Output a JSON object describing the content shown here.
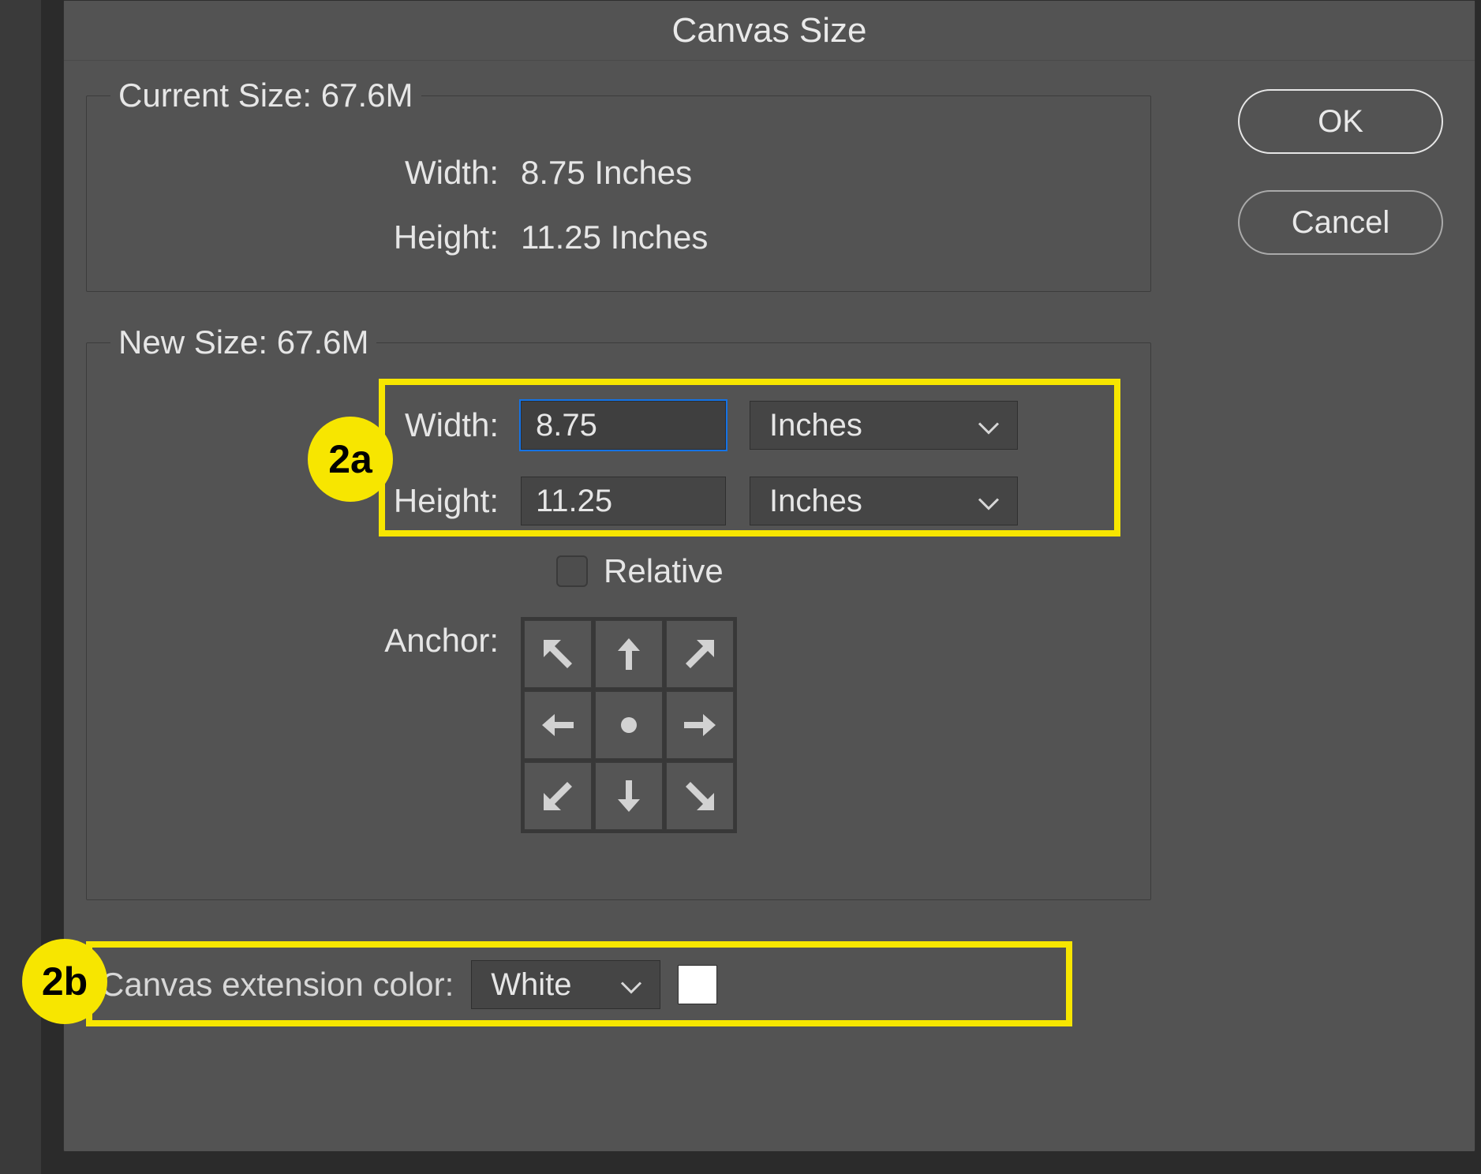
{
  "dialog": {
    "title": "Canvas Size",
    "buttons": {
      "ok": "OK",
      "cancel": "Cancel"
    }
  },
  "current_size": {
    "legend": "Current Size: 67.6M",
    "width_label": "Width:",
    "width_value": "8.75 Inches",
    "height_label": "Height:",
    "height_value": "11.25 Inches"
  },
  "new_size": {
    "legend": "New Size: 67.6M",
    "width_label": "Width:",
    "width_value": "8.75",
    "width_unit": "Inches",
    "height_label": "Height:",
    "height_value": "11.25",
    "height_unit": "Inches",
    "relative_label": "Relative",
    "relative_checked": false,
    "anchor_label": "Anchor:"
  },
  "extension": {
    "label": "Canvas extension color:",
    "value": "White",
    "swatch_color": "#ffffff"
  },
  "callouts": {
    "a": "2a",
    "b": "2b"
  }
}
